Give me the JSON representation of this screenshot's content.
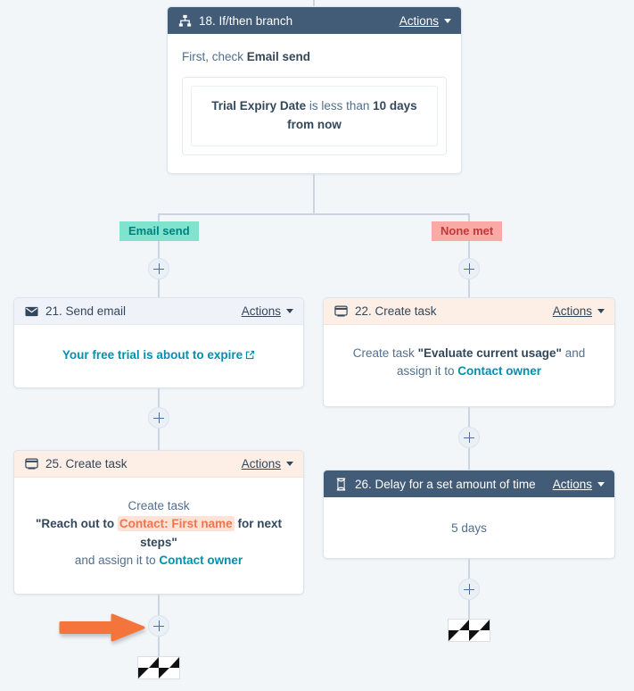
{
  "workflow": {
    "actions_label": "Actions",
    "branch_labels": {
      "yes": "Email send",
      "none": "None met"
    },
    "steps": [
      {
        "id": "step-18",
        "icon": "branch-icon",
        "title": "18. If/then branch",
        "header_style": "dark",
        "body": {
          "lead_prefix": "First, check ",
          "lead_bold": "Email send",
          "condition_bold_1": "Trial Expiry Date",
          "condition_mid": " is less than ",
          "condition_bold_2": "10 days from now"
        }
      },
      {
        "id": "step-21",
        "icon": "envelope-icon",
        "title": "21. Send email",
        "header_style": "lavender",
        "body": {
          "email_link": "Your free trial is about to expire"
        }
      },
      {
        "id": "step-22",
        "icon": "task-icon",
        "title": "22. Create task",
        "header_style": "peach",
        "body": {
          "prefix": "Create task ",
          "task_name": "\"Evaluate current usage\"",
          "mid": " and assign it to ",
          "owner": "Contact owner"
        }
      },
      {
        "id": "step-25",
        "icon": "task-icon",
        "title": "25. Create task",
        "header_style": "peach",
        "body": {
          "line1": "Create task",
          "quote_open": "\"Reach out to ",
          "token": "Contact: First name",
          "quote_close": " for next steps\"",
          "assign_prefix": "and assign it to ",
          "owner": "Contact owner"
        }
      },
      {
        "id": "step-26",
        "icon": "hourglass-icon",
        "title": "26. Delay for a set amount of time",
        "header_style": "dark",
        "body": {
          "delay": "5 days"
        }
      }
    ],
    "end_markers": {
      "label": "checkered-flag"
    },
    "annotation": {
      "arrow": "orange-arrow-pointing-right"
    },
    "colors": {
      "canvas_bg": "#f2f6f9",
      "header_dark": "#425b76",
      "header_lavender": "#f0f2fa",
      "header_peach": "#fdeee6",
      "pill_yes": "#7fe3cd",
      "pill_none": "#f9aaa5",
      "link_teal": "#0091ae",
      "token_orange": "#f2744c",
      "arrow_orange": "#f4753c",
      "connector": "#cbd6e2"
    }
  }
}
